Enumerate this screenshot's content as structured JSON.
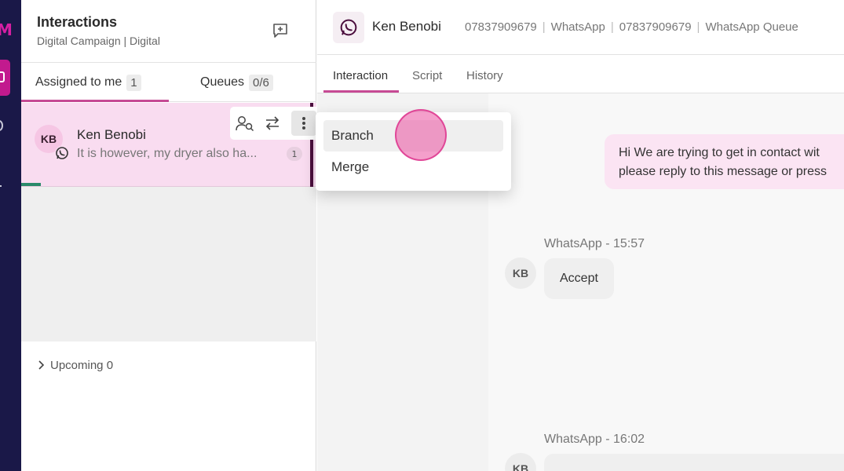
{
  "panel": {
    "title": "Interactions",
    "subtitle": "Digital Campaign | Digital",
    "tabs": [
      {
        "label": "Assigned to me",
        "count": "1"
      },
      {
        "label": "Queues",
        "count": "0/6"
      }
    ],
    "items": [
      {
        "initials": "KB",
        "name": "Ken Benobi",
        "preview": "It is however, my dryer also ha...",
        "unread": "1",
        "channel_icon": "whatsapp-icon"
      }
    ],
    "upcoming_label": "Upcoming 0"
  },
  "conversation": {
    "name": "Ken Benobi",
    "meta": [
      "07837909679",
      "WhatsApp",
      "07837909679",
      "WhatsApp Queue"
    ],
    "tabs": [
      "Interaction",
      "Script",
      "History"
    ],
    "messages": [
      {
        "line1": "Hi We are trying to get in contact wit",
        "line2": "please reply to this message or press"
      },
      {
        "meta": "WhatsApp - 15:57",
        "initials": "KB",
        "text": "Accept"
      },
      {
        "meta": "WhatsApp - 16:02",
        "initials": "KB"
      }
    ]
  },
  "menu": {
    "items": [
      "Branch",
      "Merge"
    ]
  },
  "colors": {
    "accent": "#c64a94",
    "rail": "#1a1848",
    "item_bg": "#f9dcf0"
  }
}
